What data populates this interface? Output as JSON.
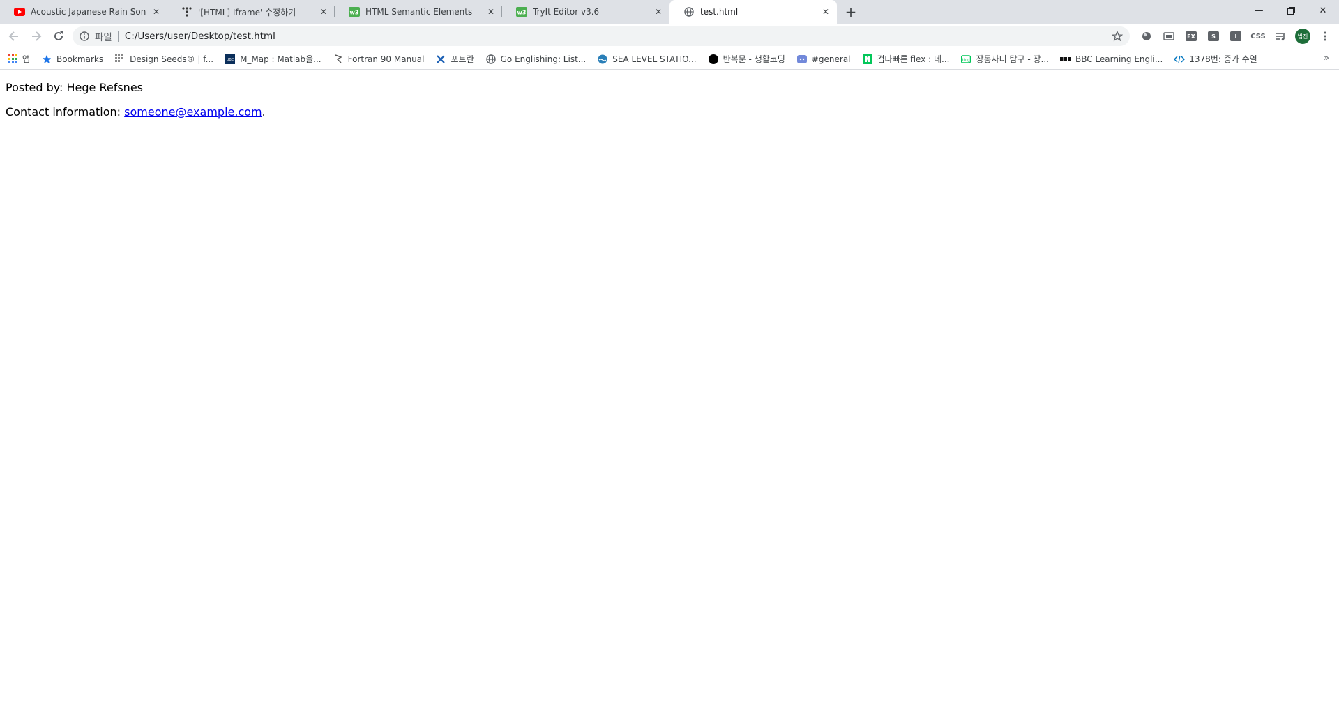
{
  "tabs": [
    {
      "title": "Acoustic Japanese Rain Songs -",
      "icon": "youtube-icon",
      "active": false
    },
    {
      "title": "'[HTML] Iframe' 수정하기",
      "icon": "tistory-icon",
      "active": false
    },
    {
      "title": "HTML Semantic Elements",
      "icon": "w3schools-icon",
      "active": false
    },
    {
      "title": "TryIt Editor v3.6",
      "icon": "w3schools-icon",
      "active": false
    },
    {
      "title": "test.html",
      "icon": "globe-icon",
      "active": true
    }
  ],
  "omnibox": {
    "scheme_label": "파일",
    "url": "C:/Users/user/Desktop/test.html"
  },
  "extensions": [
    {
      "icon": "circle-ext-icon",
      "label": ""
    },
    {
      "icon": "screen-ext-icon",
      "label": ""
    },
    {
      "icon": "ex-ext-icon",
      "label": "EX"
    },
    {
      "icon": "s-ext-icon",
      "label": "S"
    },
    {
      "icon": "i-ext-icon",
      "label": "I"
    },
    {
      "icon": "css-ext-icon",
      "label": "CSS"
    }
  ],
  "profile": {
    "avatar_text": "범진"
  },
  "bookmarks": [
    {
      "label": "앱",
      "icon": "apps-grid-icon"
    },
    {
      "label": "Bookmarks",
      "icon": "star-icon"
    },
    {
      "label": "Design Seeds® | f...",
      "icon": "design-seeds-icon"
    },
    {
      "label": "M_Map : Matlab을...",
      "icon": "ubc-icon"
    },
    {
      "label": "Fortran 90 Manual",
      "icon": "fortran-icon"
    },
    {
      "label": "포트란",
      "icon": "scissors-icon"
    },
    {
      "label": "Go Englishing: List...",
      "icon": "globe-icon"
    },
    {
      "label": "SEA LEVEL STATIO...",
      "icon": "sea-level-icon"
    },
    {
      "label": "반복문 - 생활코딩",
      "icon": "black-dot-icon"
    },
    {
      "label": "#general",
      "icon": "discord-icon"
    },
    {
      "label": "겁나빠른 flex : 네...",
      "icon": "naver-icon"
    },
    {
      "label": "장동사니 탐구 - 장...",
      "icon": "blog-icon"
    },
    {
      "label": "BBC Learning Engli...",
      "icon": "bbc-icon"
    },
    {
      "label": "1378번: 증가 수열",
      "icon": "code-icon"
    }
  ],
  "page": {
    "posted_by": "Posted by: Hege Refsnes",
    "contact_prefix": "Contact information: ",
    "contact_email": "someone@example.com",
    "contact_suffix": "."
  }
}
